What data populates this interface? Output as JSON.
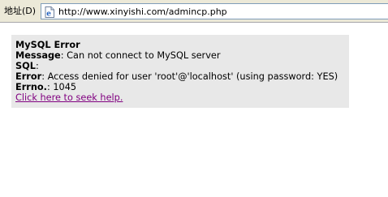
{
  "address_bar": {
    "label": "地址(D)",
    "url": "http://www.xinyishi.com/admincp.php",
    "page_icon": "ie-page-icon"
  },
  "error": {
    "title": "MySQL Error",
    "message_label": "Message",
    "message_value": ": Can not connect to MySQL server",
    "sql_label": "SQL",
    "sql_value": ":",
    "error_label": "Error",
    "error_value": ": Access denied for user 'root'@'localhost' (using password: YES)",
    "errno_label": "Errno.",
    "errno_value": ": 1045",
    "help_link": "Click here to seek help."
  },
  "colors": {
    "error_background": "#e8e8e8",
    "visited_link": "#800080",
    "toolbar": "#ece9d8"
  }
}
